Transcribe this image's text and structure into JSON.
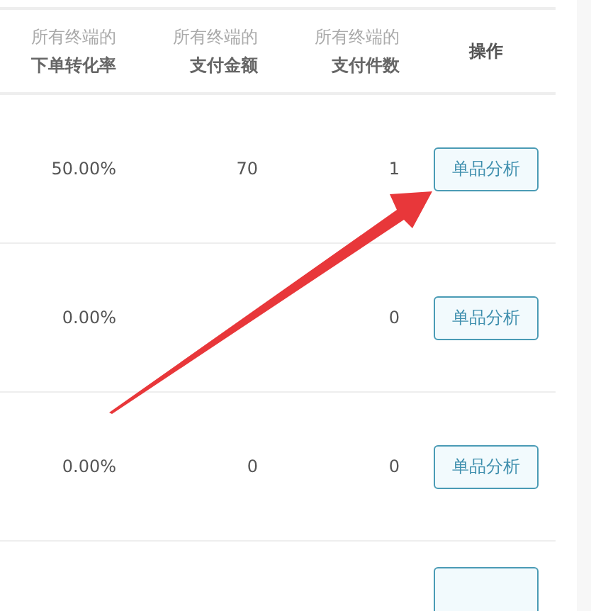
{
  "table": {
    "columns": [
      {
        "line1": "所有终端的",
        "line2": "下单转化率"
      },
      {
        "line1": "所有终端的",
        "line2": "支付金额"
      },
      {
        "line1": "所有终端的",
        "line2": "支付件数"
      },
      {
        "line2": "操作"
      }
    ],
    "rows": [
      {
        "cells": [
          "50.00%",
          "70",
          "1"
        ],
        "action": "单品分析"
      },
      {
        "cells": [
          "0.00%",
          null,
          "0"
        ],
        "action": "单品分析"
      },
      {
        "cells": [
          "0.00%",
          "0",
          "0"
        ],
        "action": "单品分析"
      }
    ]
  },
  "arrow_annotation": true
}
